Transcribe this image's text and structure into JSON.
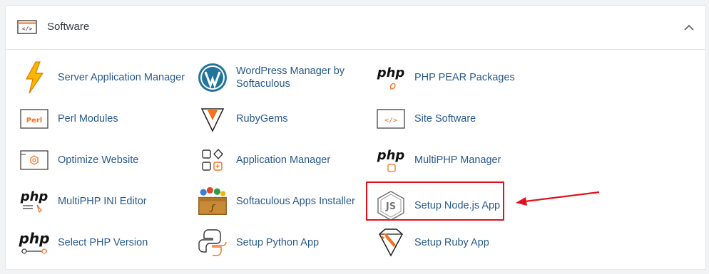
{
  "section": {
    "title": "Software",
    "header_icon": "code-window-icon",
    "collapse_icon": "chevron-up-icon"
  },
  "colors": {
    "link": "#295a8c",
    "accent_orange": "#f37021",
    "highlight_red": "#e3101c"
  },
  "items": [
    {
      "label": "Server Application Manager",
      "icon": "lightning-bolt-icon"
    },
    {
      "label": "WordPress Manager by Softaculous",
      "icon": "wordpress-logo-icon"
    },
    {
      "label": "PHP PEAR Packages",
      "icon": "php-pear-icon"
    },
    {
      "label": "Perl Modules",
      "icon": "perl-icon"
    },
    {
      "label": "RubyGems",
      "icon": "ruby-gem-icon"
    },
    {
      "label": "Site Software",
      "icon": "code-window-icon"
    },
    {
      "label": "Optimize Website",
      "icon": "gear-window-icon"
    },
    {
      "label": "Application Manager",
      "icon": "app-grid-icon"
    },
    {
      "label": "MultiPHP Manager",
      "icon": "php-manager-icon"
    },
    {
      "label": "MultiPHP INI Editor",
      "icon": "php-ini-icon"
    },
    {
      "label": "Softaculous Apps Installer",
      "icon": "softaculous-box-icon"
    },
    {
      "label": "Setup Node.js App",
      "icon": "nodejs-hexagon-icon"
    },
    {
      "label": "Select PHP Version",
      "icon": "php-version-icon"
    },
    {
      "label": "Setup Python App",
      "icon": "python-logo-icon"
    },
    {
      "label": "Setup Ruby App",
      "icon": "ruby-wrench-icon"
    }
  ],
  "php_text": "php",
  "perl_text": "Perl",
  "code_glyph": "</>"
}
